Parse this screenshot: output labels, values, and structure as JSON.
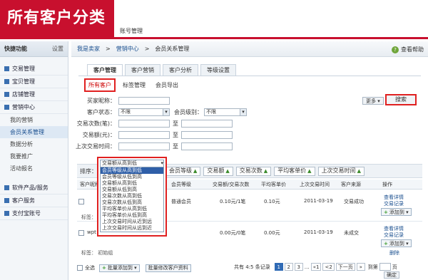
{
  "banner": {
    "title": "所有客户分类"
  },
  "app": {
    "title": "账号管理"
  },
  "sidebar": {
    "header": "快捷功能",
    "settings": "设置",
    "items": [
      {
        "label": "交易管理"
      },
      {
        "label": "宝贝管理"
      },
      {
        "label": "店铺管理"
      },
      {
        "label": "营销中心"
      }
    ],
    "sub_items": [
      {
        "label": "我的营销"
      },
      {
        "label": "会员关系管理"
      },
      {
        "label": "数据分析"
      },
      {
        "label": "我要推广"
      },
      {
        "label": "活动报名"
      }
    ],
    "more_items": [
      {
        "label": "软件产品/服务"
      },
      {
        "label": "客户服务"
      },
      {
        "label": "支付宝账号"
      }
    ]
  },
  "breadcrumb": [
    "我是卖家",
    "营销中心",
    "会员关系管理"
  ],
  "help": "查看帮助",
  "tabs": [
    {
      "label": "客户管理",
      "active": true
    },
    {
      "label": "客户营销"
    },
    {
      "label": "客户分析"
    },
    {
      "label": "等级设置"
    }
  ],
  "subtabs": [
    {
      "label": "所有客户",
      "active": true
    },
    {
      "label": "标签管理"
    },
    {
      "label": "会员导出"
    }
  ],
  "form": {
    "buyer_name_label": "买家昵称：",
    "status_label": "客户状态：",
    "status_value": "不限",
    "level_label": "会员级别：",
    "level_value": "不限",
    "trade_count_label": "交易次数(笔)：",
    "trade_amount_label": "交易额(元)：",
    "last_trade_label": "上次交易时间：",
    "range_sep": "至",
    "more_button": "更多",
    "search_button": "搜索"
  },
  "sort": {
    "label": "排序：",
    "dropdown_value": "交易额从高到低",
    "buttons": [
      {
        "label": "会员等级"
      },
      {
        "label": "交易额"
      },
      {
        "label": "交易次数"
      },
      {
        "label": "平均客单价"
      },
      {
        "label": "上次交易时间"
      }
    ],
    "options": [
      {
        "label": "会员等级从高到低",
        "selected": true
      },
      {
        "label": "会员等级从低到高"
      },
      {
        "label": "交易额从高到低"
      },
      {
        "label": "交易额从低到高"
      },
      {
        "label": "交易次数从高到低"
      },
      {
        "label": "交易次数从低到高"
      },
      {
        "label": "平均客单价从高到低"
      },
      {
        "label": "平均客单价从低到高"
      },
      {
        "label": "上次交易时间从近到远"
      },
      {
        "label": "上次交易时间从远到近"
      }
    ]
  },
  "table": {
    "headers": [
      "客户昵称",
      "会员等级",
      "交易额/交易次数",
      "平均客单价",
      "上次交易时间",
      "客户来源",
      "操作"
    ],
    "rows": [
      {
        "level": "普通会员",
        "amount": "0.10元/1笔",
        "avg": "0.10元",
        "last": "2011-03-19",
        "source": "交易成功",
        "op1": "查看详情",
        "op2": "交易记录",
        "add": "添加到",
        "tag": "标签："
      },
      {
        "name": "wpt",
        "amount": "0.00元/0笔",
        "avg": "0.00元",
        "last": "2011-03-19",
        "source": "未成交",
        "op1": "查看详情",
        "op2": "交易记录",
        "add": "添加到",
        "del": "删除",
        "tag": "标签：",
        "tag_value": "初始组"
      }
    ]
  },
  "footer": {
    "select_all": "全选",
    "batch_add": "批量添加到",
    "batch_edit": "批量修改客户资料",
    "total": "共有 4:5 条记录",
    "pages": [
      "1",
      "2",
      "3"
    ],
    "prev": "上一页",
    "next": "下一页",
    "jump_to": "到第",
    "page_unit": "页",
    "confirm": "确定"
  }
}
